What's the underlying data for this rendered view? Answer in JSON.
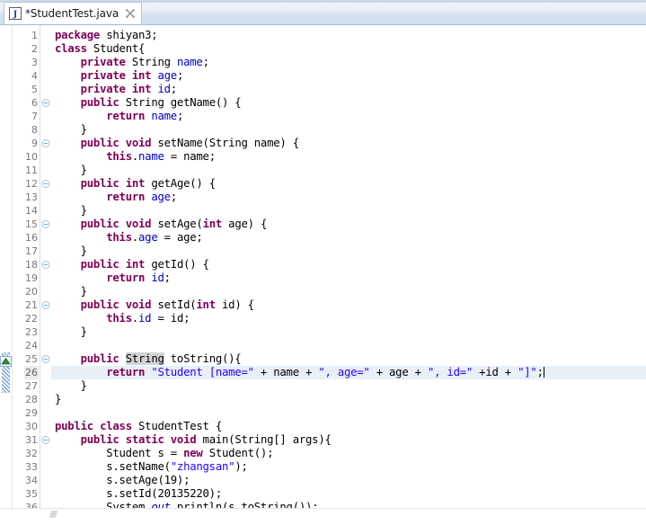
{
  "window": {
    "title": "*StudentTest.java",
    "app": "Eclipse IDE Java Editor"
  },
  "tab": {
    "label": "*StudentTest.java",
    "dirty": true,
    "file_icon": "java-file-icon",
    "close_icon": "close-icon"
  },
  "editor": {
    "language": "java",
    "caret_line": 26,
    "caret_column": 69,
    "first_visible_line": 1,
    "last_visible_line": 36,
    "colors": {
      "keyword": "#7F0055",
      "field": "#0000C0",
      "string": "#2A00FF",
      "static_field": "#0000C0",
      "caret_line_background": "#E8EFF7",
      "occurrence_highlight": "#D4D4D4",
      "line_number": "#787878",
      "background": "#FFFFFF",
      "change_bar": "#7FA8D4",
      "collapse_marker": "#2E8B2E"
    },
    "gutter": {
      "folding_markers_collapse": [
        6,
        9,
        12,
        15,
        18,
        21,
        25,
        31
      ],
      "collapse_arrow_line": 25,
      "change_bar_lines": [
        25,
        26,
        27
      ]
    },
    "lines": [
      {
        "n": 1,
        "tokens": [
          {
            "t": "kw",
            "v": "package"
          },
          {
            "t": "plain",
            "v": " shiyan3;"
          }
        ]
      },
      {
        "n": 2,
        "tokens": [
          {
            "t": "kw",
            "v": "class"
          },
          {
            "t": "plain",
            "v": " Student{"
          }
        ]
      },
      {
        "n": 3,
        "tokens": [
          {
            "t": "plain",
            "v": "    "
          },
          {
            "t": "kw",
            "v": "private"
          },
          {
            "t": "plain",
            "v": " String "
          },
          {
            "t": "fld",
            "v": "name"
          },
          {
            "t": "plain",
            "v": ";"
          }
        ]
      },
      {
        "n": 4,
        "tokens": [
          {
            "t": "plain",
            "v": "    "
          },
          {
            "t": "kw",
            "v": "private"
          },
          {
            "t": "plain",
            "v": " "
          },
          {
            "t": "kw",
            "v": "int"
          },
          {
            "t": "plain",
            "v": " "
          },
          {
            "t": "fld",
            "v": "age"
          },
          {
            "t": "plain",
            "v": ";"
          }
        ]
      },
      {
        "n": 5,
        "tokens": [
          {
            "t": "plain",
            "v": "    "
          },
          {
            "t": "kw",
            "v": "private"
          },
          {
            "t": "plain",
            "v": " "
          },
          {
            "t": "kw",
            "v": "int"
          },
          {
            "t": "plain",
            "v": " "
          },
          {
            "t": "fld",
            "v": "id"
          },
          {
            "t": "plain",
            "v": ";"
          }
        ]
      },
      {
        "n": 6,
        "tokens": [
          {
            "t": "plain",
            "v": "    "
          },
          {
            "t": "kw",
            "v": "public"
          },
          {
            "t": "plain",
            "v": " String getName() {"
          }
        ]
      },
      {
        "n": 7,
        "tokens": [
          {
            "t": "plain",
            "v": "        "
          },
          {
            "t": "kw",
            "v": "return"
          },
          {
            "t": "plain",
            "v": " "
          },
          {
            "t": "fld",
            "v": "name"
          },
          {
            "t": "plain",
            "v": ";"
          }
        ]
      },
      {
        "n": 8,
        "tokens": [
          {
            "t": "plain",
            "v": "    }"
          }
        ]
      },
      {
        "n": 9,
        "tokens": [
          {
            "t": "plain",
            "v": "    "
          },
          {
            "t": "kw",
            "v": "public"
          },
          {
            "t": "plain",
            "v": " "
          },
          {
            "t": "kw",
            "v": "void"
          },
          {
            "t": "plain",
            "v": " setName(String name) {"
          }
        ]
      },
      {
        "n": 10,
        "tokens": [
          {
            "t": "plain",
            "v": "        "
          },
          {
            "t": "kw",
            "v": "this"
          },
          {
            "t": "plain",
            "v": "."
          },
          {
            "t": "fld",
            "v": "name"
          },
          {
            "t": "plain",
            "v": " = name;"
          }
        ]
      },
      {
        "n": 11,
        "tokens": [
          {
            "t": "plain",
            "v": "    }"
          }
        ]
      },
      {
        "n": 12,
        "tokens": [
          {
            "t": "plain",
            "v": "    "
          },
          {
            "t": "kw",
            "v": "public"
          },
          {
            "t": "plain",
            "v": " "
          },
          {
            "t": "kw",
            "v": "int"
          },
          {
            "t": "plain",
            "v": " getAge() {"
          }
        ]
      },
      {
        "n": 13,
        "tokens": [
          {
            "t": "plain",
            "v": "        "
          },
          {
            "t": "kw",
            "v": "return"
          },
          {
            "t": "plain",
            "v": " "
          },
          {
            "t": "fld",
            "v": "age"
          },
          {
            "t": "plain",
            "v": ";"
          }
        ]
      },
      {
        "n": 14,
        "tokens": [
          {
            "t": "plain",
            "v": "    }"
          }
        ]
      },
      {
        "n": 15,
        "tokens": [
          {
            "t": "plain",
            "v": "    "
          },
          {
            "t": "kw",
            "v": "public"
          },
          {
            "t": "plain",
            "v": " "
          },
          {
            "t": "kw",
            "v": "void"
          },
          {
            "t": "plain",
            "v": " setAge("
          },
          {
            "t": "kw",
            "v": "int"
          },
          {
            "t": "plain",
            "v": " age) {"
          }
        ]
      },
      {
        "n": 16,
        "tokens": [
          {
            "t": "plain",
            "v": "        "
          },
          {
            "t": "kw",
            "v": "this"
          },
          {
            "t": "plain",
            "v": "."
          },
          {
            "t": "fld",
            "v": "age"
          },
          {
            "t": "plain",
            "v": " = age;"
          }
        ]
      },
      {
        "n": 17,
        "tokens": [
          {
            "t": "plain",
            "v": "    }"
          }
        ]
      },
      {
        "n": 18,
        "tokens": [
          {
            "t": "plain",
            "v": "    "
          },
          {
            "t": "kw",
            "v": "public"
          },
          {
            "t": "plain",
            "v": " "
          },
          {
            "t": "kw",
            "v": "int"
          },
          {
            "t": "plain",
            "v": " getId() {"
          }
        ]
      },
      {
        "n": 19,
        "tokens": [
          {
            "t": "plain",
            "v": "        "
          },
          {
            "t": "kw",
            "v": "return"
          },
          {
            "t": "plain",
            "v": " "
          },
          {
            "t": "fld",
            "v": "id"
          },
          {
            "t": "plain",
            "v": ";"
          }
        ]
      },
      {
        "n": 20,
        "tokens": [
          {
            "t": "plain",
            "v": "    }"
          }
        ]
      },
      {
        "n": 21,
        "tokens": [
          {
            "t": "plain",
            "v": "    "
          },
          {
            "t": "kw",
            "v": "public"
          },
          {
            "t": "plain",
            "v": " "
          },
          {
            "t": "kw",
            "v": "void"
          },
          {
            "t": "plain",
            "v": " setId("
          },
          {
            "t": "kw",
            "v": "int"
          },
          {
            "t": "plain",
            "v": " id) {"
          }
        ]
      },
      {
        "n": 22,
        "tokens": [
          {
            "t": "plain",
            "v": "        "
          },
          {
            "t": "kw",
            "v": "this"
          },
          {
            "t": "plain",
            "v": "."
          },
          {
            "t": "fld",
            "v": "id"
          },
          {
            "t": "plain",
            "v": " = id;"
          }
        ]
      },
      {
        "n": 23,
        "tokens": [
          {
            "t": "plain",
            "v": "    }"
          }
        ]
      },
      {
        "n": 24,
        "tokens": [
          {
            "t": "plain",
            "v": ""
          }
        ]
      },
      {
        "n": 25,
        "tokens": [
          {
            "t": "plain",
            "v": "    "
          },
          {
            "t": "kw",
            "v": "public"
          },
          {
            "t": "plain",
            "v": " "
          },
          {
            "t": "occ",
            "v": "String"
          },
          {
            "t": "plain",
            "v": " toString(){"
          }
        ]
      },
      {
        "n": 26,
        "caret": true,
        "tokens": [
          {
            "t": "plain",
            "v": "        "
          },
          {
            "t": "kw",
            "v": "return"
          },
          {
            "t": "plain",
            "v": " "
          },
          {
            "t": "str",
            "v": "\"Student [name=\""
          },
          {
            "t": "plain",
            "v": " + name + "
          },
          {
            "t": "str",
            "v": "\", age=\""
          },
          {
            "t": "plain",
            "v": " + age + "
          },
          {
            "t": "str",
            "v": "\", id=\""
          },
          {
            "t": "plain",
            "v": " +id + "
          },
          {
            "t": "str",
            "v": "\"]\""
          },
          {
            "t": "plain",
            "v": ";"
          }
        ]
      },
      {
        "n": 27,
        "tokens": [
          {
            "t": "plain",
            "v": "    }"
          }
        ]
      },
      {
        "n": 28,
        "tokens": [
          {
            "t": "plain",
            "v": "}"
          }
        ]
      },
      {
        "n": 29,
        "tokens": [
          {
            "t": "plain",
            "v": ""
          }
        ]
      },
      {
        "n": 30,
        "tokens": [
          {
            "t": "kw",
            "v": "public"
          },
          {
            "t": "plain",
            "v": " "
          },
          {
            "t": "kw",
            "v": "class"
          },
          {
            "t": "plain",
            "v": " StudentTest {"
          }
        ]
      },
      {
        "n": 31,
        "tokens": [
          {
            "t": "plain",
            "v": "    "
          },
          {
            "t": "kw",
            "v": "public"
          },
          {
            "t": "plain",
            "v": " "
          },
          {
            "t": "kw",
            "v": "static"
          },
          {
            "t": "plain",
            "v": " "
          },
          {
            "t": "kw",
            "v": "void"
          },
          {
            "t": "plain",
            "v": " main(String[] args){"
          }
        ]
      },
      {
        "n": 32,
        "tokens": [
          {
            "t": "plain",
            "v": "        Student s = "
          },
          {
            "t": "kw",
            "v": "new"
          },
          {
            "t": "plain",
            "v": " Student();"
          }
        ]
      },
      {
        "n": 33,
        "tokens": [
          {
            "t": "plain",
            "v": "        s.setName("
          },
          {
            "t": "str",
            "v": "\"zhangsan\""
          },
          {
            "t": "plain",
            "v": ");"
          }
        ]
      },
      {
        "n": 34,
        "tokens": [
          {
            "t": "plain",
            "v": "        s.setAge(19);"
          }
        ]
      },
      {
        "n": 35,
        "tokens": [
          {
            "t": "plain",
            "v": "        s.setId(20135220);"
          }
        ]
      },
      {
        "n": 36,
        "tokens": [
          {
            "t": "plain",
            "v": "        System."
          },
          {
            "t": "stat",
            "v": "out"
          },
          {
            "t": "plain",
            "v": ".println(s.toString());"
          }
        ]
      }
    ]
  }
}
